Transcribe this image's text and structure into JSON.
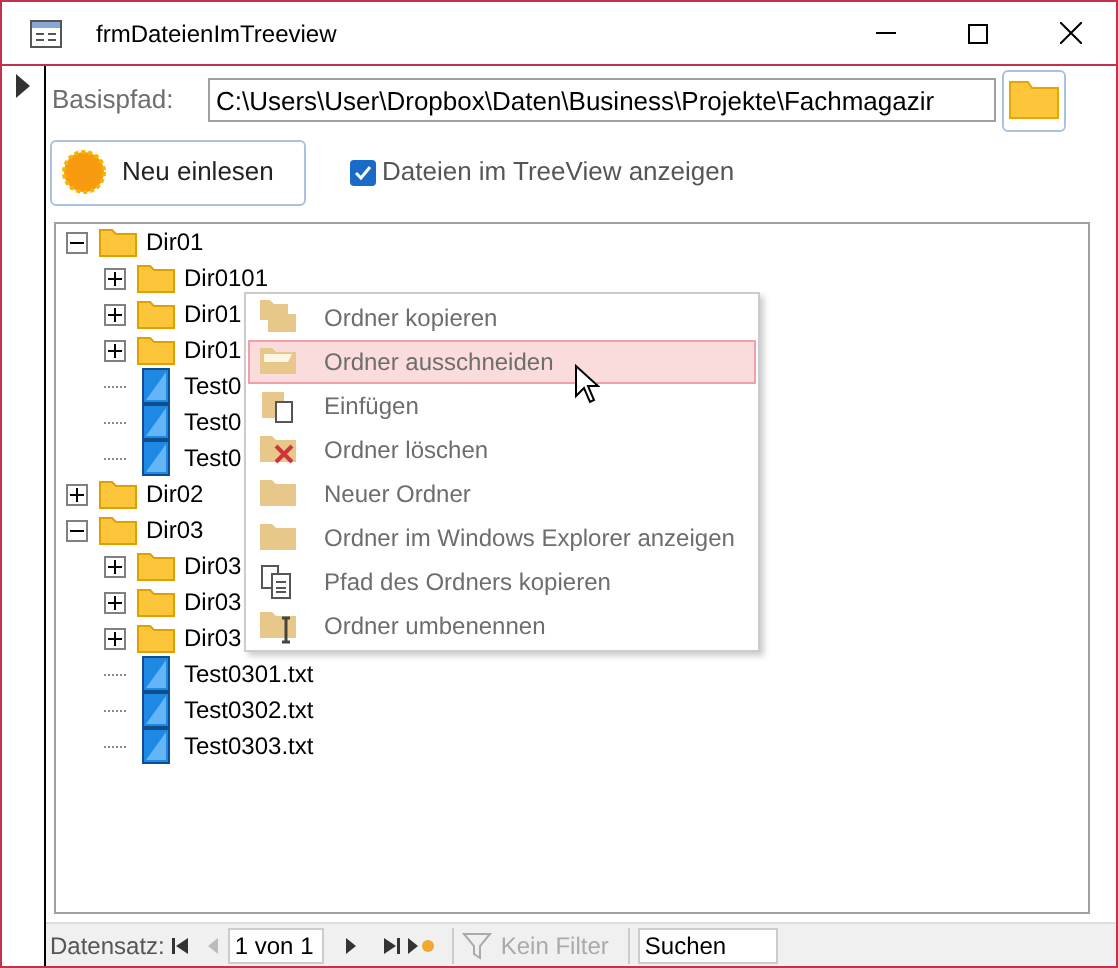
{
  "window": {
    "title": "frmDateienImTreeview"
  },
  "path_label": "Basispfad:",
  "path_value": "C:\\Users\\User\\Dropbox\\Daten\\Business\\Projekte\\Fachmagazir",
  "reload_button": "Neu einlesen",
  "show_files": {
    "label": "Dateien im TreeView anzeigen",
    "checked": true
  },
  "tree": [
    {
      "kind": "folder",
      "label": "Dir01",
      "expanded": true,
      "children": [
        {
          "kind": "folder",
          "label": "Dir0101",
          "expanded": false
        },
        {
          "kind": "folder",
          "label": "Dir01",
          "expanded": false
        },
        {
          "kind": "folder",
          "label": "Dir01",
          "expanded": false
        },
        {
          "kind": "file",
          "label": "Test0"
        },
        {
          "kind": "file",
          "label": "Test0"
        },
        {
          "kind": "file",
          "label": "Test0"
        }
      ]
    },
    {
      "kind": "folder",
      "label": "Dir02",
      "expanded": false
    },
    {
      "kind": "folder",
      "label": "Dir03",
      "expanded": true,
      "children": [
        {
          "kind": "folder",
          "label": "Dir03",
          "expanded": false
        },
        {
          "kind": "folder",
          "label": "Dir03",
          "expanded": false
        },
        {
          "kind": "folder",
          "label": "Dir03",
          "expanded": false
        },
        {
          "kind": "file",
          "label": "Test0301.txt"
        },
        {
          "kind": "file",
          "label": "Test0302.txt"
        },
        {
          "kind": "file",
          "label": "Test0303.txt"
        }
      ]
    }
  ],
  "context_menu": [
    {
      "kind": "copy",
      "label": "Ordner kopieren",
      "selected": false
    },
    {
      "kind": "cut",
      "label": "Ordner ausschneiden",
      "selected": true
    },
    {
      "kind": "paste",
      "label": "Einfügen",
      "selected": false
    },
    {
      "kind": "delete",
      "label": "Ordner löschen",
      "selected": false
    },
    {
      "kind": "new",
      "label": "Neuer Ordner",
      "selected": false
    },
    {
      "kind": "explorer",
      "label": "Ordner im Windows Explorer anzeigen",
      "selected": false
    },
    {
      "kind": "copypath",
      "label": "Pfad des Ordners kopieren",
      "selected": false
    },
    {
      "kind": "rename",
      "label": "Ordner umbenennen",
      "selected": false
    }
  ],
  "record_nav": {
    "label": "Datensatz:",
    "position": "1 von 1",
    "filter": "Kein Filter",
    "search": "Suchen"
  }
}
